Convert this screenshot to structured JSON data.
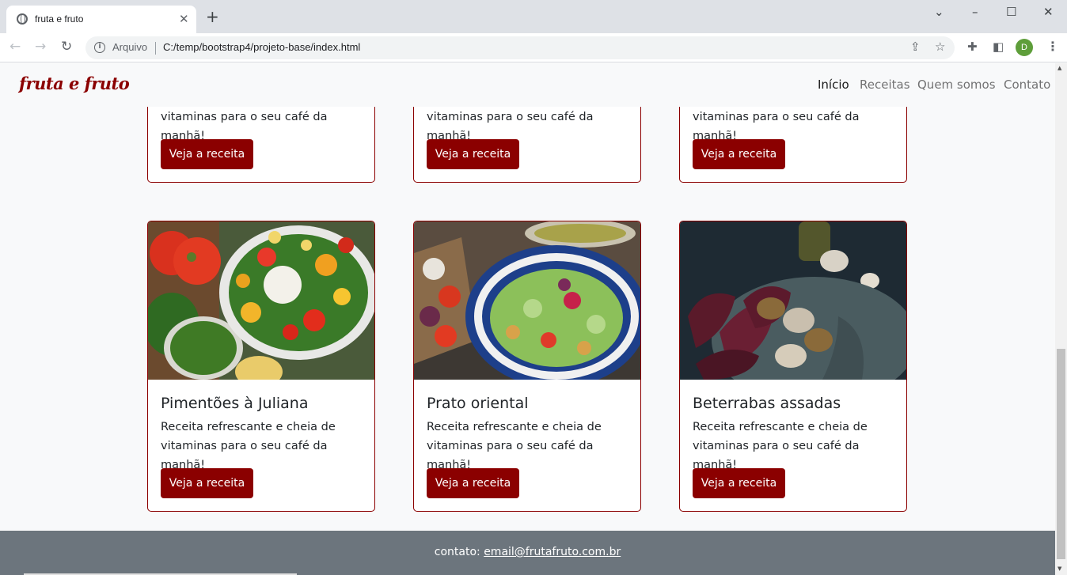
{
  "browser": {
    "tab_title": "fruta e fruto",
    "tab_close": "✕",
    "new_tab": "+",
    "scheme_label": "Arquivo",
    "url": "C:/temp/bootstrap4/projeto-base/index.html",
    "profile_initial": "D",
    "window_controls": {
      "dropdown": "⌄",
      "minimize": "–",
      "maximize": "☐",
      "close": "✕"
    },
    "icons": [
      "globe-icon",
      "back-icon",
      "forward-icon",
      "reload-icon",
      "info-icon",
      "share-icon",
      "star-icon",
      "extensions-icon",
      "sidepanel-icon",
      "menu-icon"
    ]
  },
  "site": {
    "brand": "fruta e fruto",
    "nav": [
      "Início",
      "Receitas",
      "Quem somos",
      "Contato"
    ],
    "active_nav": "Início"
  },
  "top_cards": [
    {
      "text": "vitaminas para o seu café da manhã!",
      "button": "Veja a receita"
    },
    {
      "text": "vitaminas para o seu café da manhã!",
      "button": "Veja a receita"
    },
    {
      "text": "vitaminas para o seu café da manhã!",
      "button": "Veja a receita"
    }
  ],
  "cards": [
    {
      "title": "Pimentões à Juliana",
      "text1": "Receita refrescante e cheia de",
      "text2": "vitaminas para o seu café da manhã!",
      "button": "Veja a receita",
      "image": "salad-peppers-photo"
    },
    {
      "title": "Prato oriental",
      "text1": "Receita refrescante e cheia de",
      "text2": "vitaminas para o seu café da manhã!",
      "button": "Veja a receita",
      "image": "salad-bowl-photo"
    },
    {
      "title": "Beterrabas assadas",
      "text1": "Receita refrescante e cheia de",
      "text2": "vitaminas para o seu café da manhã!",
      "button": "Veja a receita",
      "image": "roasted-beets-photo"
    }
  ],
  "footer": {
    "label": "contato:",
    "email": "email@frutafruto.com.br"
  },
  "colors": {
    "brand": "#8b0000",
    "footer_bg": "#6c757d",
    "page_bg": "#f8f9fa"
  }
}
